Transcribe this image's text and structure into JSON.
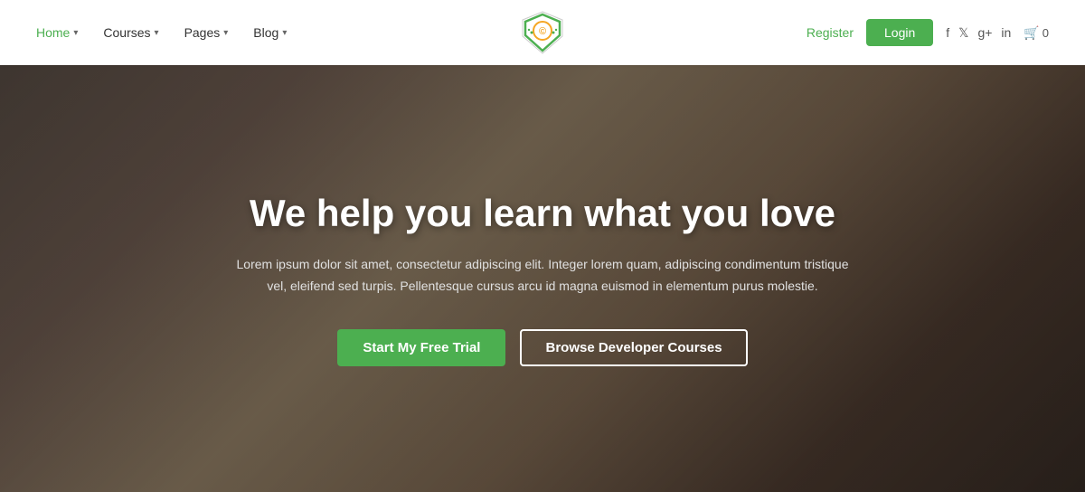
{
  "header": {
    "nav": [
      {
        "label": "Home",
        "active": true,
        "has_dropdown": true
      },
      {
        "label": "Courses",
        "active": false,
        "has_dropdown": true
      },
      {
        "label": "Pages",
        "active": false,
        "has_dropdown": true
      },
      {
        "label": "Blog",
        "active": false,
        "has_dropdown": true
      }
    ],
    "logo_alt": "EduShield Logo",
    "register_label": "Register",
    "login_label": "Login",
    "social": [
      "f",
      "t",
      "g+",
      "in"
    ],
    "cart_count": "0"
  },
  "hero": {
    "title": "We help you learn what you love",
    "subtitle": "Lorem ipsum dolor sit amet, consectetur adipiscing elit. Integer lorem quam, adipiscing condimentum tristique vel, eleifend sed turpis. Pellentesque cursus arcu id magna euismod in elementum purus molestie.",
    "btn_primary": "Start My Free Trial",
    "btn_secondary": "Browse Developer Courses"
  }
}
